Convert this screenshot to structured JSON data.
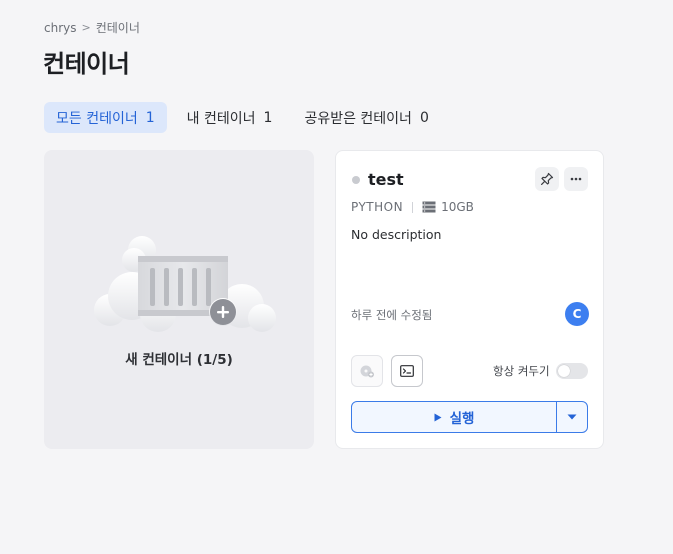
{
  "breadcrumb": {
    "root": "chrys",
    "separator": ">",
    "current": "컨테이너"
  },
  "page": {
    "title": "컨테이너"
  },
  "tabs": [
    {
      "label": "모든 컨테이너",
      "count": "1",
      "active": true
    },
    {
      "label": "내 컨테이너",
      "count": "1",
      "active": false
    },
    {
      "label": "공유받은 컨테이너",
      "count": "0",
      "active": false
    }
  ],
  "new_container": {
    "label": "새 컨테이너 (1/5)"
  },
  "container": {
    "name": "test",
    "status_color": "#c9cbd0",
    "language": "PYTHON",
    "storage": "10GB",
    "description": "No description",
    "modified": "하루 전에 수정됨",
    "owner_initial": "C",
    "always_on_label": "항상 켜두기",
    "always_on": false,
    "run_label": "실행"
  },
  "icons": {
    "pin": "pin-icon",
    "more": "more-horizontal-icon",
    "storage": "storage-icon",
    "disc": "disc-plus-icon",
    "terminal": "terminal-icon",
    "play": "play-icon",
    "caret": "caret-down-icon"
  },
  "colors": {
    "accent": "#2463d6",
    "accent_bg": "#dce7fb",
    "avatar": "#3d7ff0"
  }
}
